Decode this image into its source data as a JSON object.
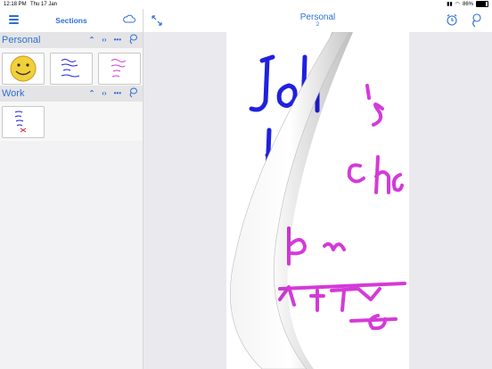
{
  "status_bar": {
    "time": "12:18 PM",
    "date": "Thu 17 Jan",
    "battery": "86%",
    "battery_level": 0.86
  },
  "sidebar": {
    "title": "Sections",
    "sections": [
      {
        "name": "Personal",
        "notes": 3
      },
      {
        "name": "Work",
        "notes": 1
      }
    ]
  },
  "main": {
    "title": "Personal",
    "page_number": "2"
  },
  "colors": {
    "accent": "#2f6fd8",
    "ink_blue": "#2020e0",
    "ink_magenta": "#d43ad8"
  },
  "icons": [
    "menu-icon",
    "cloud-icon",
    "chevron-up-icon",
    "code-icon",
    "more-icon",
    "lasso-icon",
    "expand-icon",
    "alarm-icon"
  ]
}
